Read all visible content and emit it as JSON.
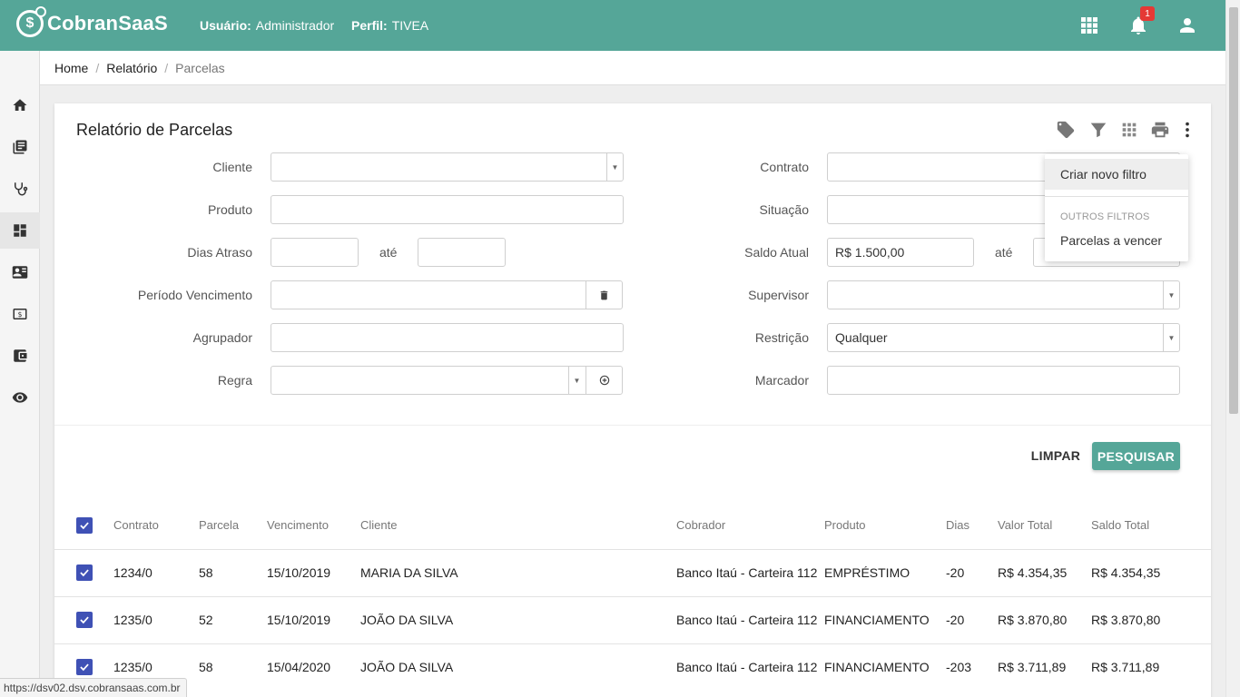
{
  "app": {
    "name": "CobranSaaS",
    "user_label": "Usuário:",
    "user_value": "Administrador",
    "profile_label": "Perfil:",
    "profile_value": "TIVEA",
    "notification_count": "1"
  },
  "header_icons": [
    "apps-grid-icon",
    "bell-icon",
    "account-icon"
  ],
  "sidebar": {
    "items": [
      "home-icon",
      "book-icon",
      "stethoscope-icon",
      "dashboard-icon",
      "contact-card-icon",
      "money-icon",
      "wallet-icon",
      "eye-icon"
    ],
    "active_index": 3
  },
  "breadcrumb": [
    "Home",
    "Relatório",
    "Parcelas"
  ],
  "card": {
    "title": "Relatório de Parcelas",
    "toolbar": [
      "tag-icon",
      "filter-icon",
      "grid-icon",
      "print-icon",
      "more-vert-icon"
    ]
  },
  "form": {
    "cliente": {
      "label": "Cliente",
      "value": ""
    },
    "produto": {
      "label": "Produto",
      "value": ""
    },
    "dias_atraso": {
      "label": "Dias Atraso",
      "from": "",
      "to_label": "até",
      "to": ""
    },
    "periodo_vencimento": {
      "label": "Período Vencimento",
      "value": ""
    },
    "agrupador": {
      "label": "Agrupador",
      "value": ""
    },
    "regra": {
      "label": "Regra",
      "value": ""
    },
    "contrato": {
      "label": "Contrato",
      "value": ""
    },
    "situacao": {
      "label": "Situação",
      "value": ""
    },
    "saldo_atual": {
      "label": "Saldo Atual",
      "from": "R$ 1.500,00",
      "to_label": "até",
      "to": ""
    },
    "supervisor": {
      "label": "Supervisor",
      "value": ""
    },
    "restricao": {
      "label": "Restrição",
      "value": "Qualquer"
    },
    "marcador": {
      "label": "Marcador",
      "value": ""
    }
  },
  "actions": {
    "clear": "LIMPAR",
    "search": "PESQUISAR"
  },
  "table": {
    "columns": [
      "Contrato",
      "Parcela",
      "Vencimento",
      "Cliente",
      "Cobrador",
      "Produto",
      "Dias",
      "Valor Total",
      "Saldo Total"
    ],
    "rows": [
      [
        "1234/0",
        "58",
        "15/10/2019",
        "MARIA DA SILVA",
        "Banco Itaú - Carteira 112",
        "EMPRÉSTIMO",
        "-20",
        "R$ 4.354,35",
        "R$ 4.354,35"
      ],
      [
        "1235/0",
        "52",
        "15/10/2019",
        "JOÃO DA SILVA",
        "Banco Itaú - Carteira 112",
        "FINANCIAMENTO",
        "-20",
        "R$ 3.870,80",
        "R$ 3.870,80"
      ],
      [
        "1235/0",
        "58",
        "15/04/2020",
        "JOÃO DA SILVA",
        "Banco Itaú - Carteira 112",
        "FINANCIAMENTO",
        "-203",
        "R$ 3.711,89",
        "R$ 3.711,89"
      ]
    ]
  },
  "menu": {
    "create": "Criar novo filtro",
    "section": "OUTROS FILTROS",
    "items": [
      "Parcelas a vencer"
    ]
  },
  "status_url": "https://dsv02.dsv.cobransaas.com.br",
  "colors": {
    "primary": "#55a698",
    "checkbox": "#3f51b5",
    "badge": "#e53935"
  }
}
